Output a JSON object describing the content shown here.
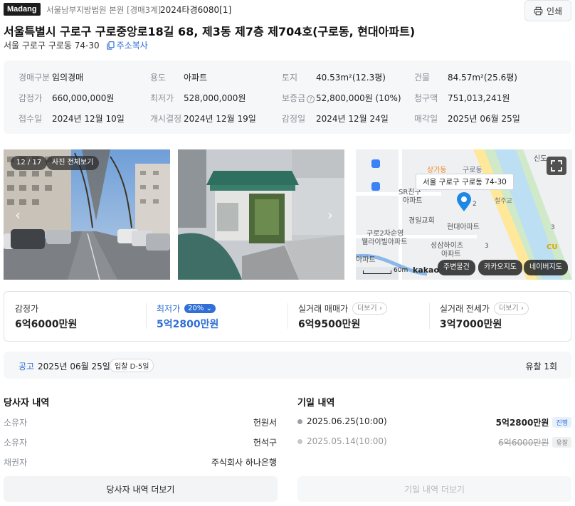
{
  "header": {
    "logo": "Madang",
    "court": "서울남부지방법원 본원 [경매3계]",
    "case_no": "2024타경6080[1]",
    "print_label": "인쇄"
  },
  "title": "서울특별시 구로구 구로중앙로18길 68, 제3동 제7층 제704호(구로동, 현대아파트)",
  "sub_address": "서울 구로구 구로동 74-30",
  "copy_label": "주소복사",
  "info": [
    [
      {
        "label": "경매구분",
        "value": "임의경매"
      },
      {
        "label": "용도",
        "value": "아파트"
      },
      {
        "label": "토지",
        "value": "40.53m²(12.3평)"
      },
      {
        "label": "건물",
        "value": "84.57m²(25.6평)"
      }
    ],
    [
      {
        "label": "감정가",
        "value": "660,000,000원"
      },
      {
        "label": "최저가",
        "value": "528,000,000원"
      },
      {
        "label": "보증금",
        "value": "52,800,000원 (10%)"
      },
      {
        "label": "청구액",
        "value": "751,013,241원"
      }
    ],
    [
      {
        "label": "접수일",
        "value": "2024년 12월 10일"
      },
      {
        "label": "개시결정",
        "value": "2024년 12월 19일"
      },
      {
        "label": "감정일",
        "value": "2024년 12월 24일"
      },
      {
        "label": "매각일",
        "value": "2025년 06월 25일"
      }
    ]
  ],
  "photos": {
    "counter": "12 / 17",
    "view_all": "사진 전체보기"
  },
  "map": {
    "popup": "서울 구로구 구로동 74-30",
    "labels": [
      "상가동",
      "구로동",
      "SR친구",
      "아파트",
      "경일교회",
      "구로2차순영",
      "웰라이빌아파트",
      "현대아파트",
      "성삼하이츠",
      "아파트",
      "아파트",
      "신도",
      "CU",
      "철주교",
      "2",
      "3",
      "3"
    ],
    "scale": "60m",
    "brand": "kakao",
    "buttons": [
      "주변물건",
      "카카오지도",
      "네이버지도"
    ]
  },
  "price": {
    "appraisal_label": "감정가",
    "appraisal_value": "6억6000만원",
    "min_label": "최저가",
    "min_badge": "20%",
    "min_value": "5억2800만원",
    "sale_label": "실거래 매매가",
    "sale_more": "더보기",
    "sale_value": "6억9500만원",
    "lease_label": "실거래 전세가",
    "lease_more": "더보기",
    "lease_value": "3억7000만원"
  },
  "notice": {
    "label": "공고",
    "date": "2025년 06월 25일",
    "dday": "입찰 D-5일",
    "result": "유찰 1회"
  },
  "parties": {
    "title": "당사자 내역",
    "rows": [
      {
        "role": "소유자",
        "name": "헌원서"
      },
      {
        "role": "소유자",
        "name": "헌석구"
      },
      {
        "role": "채권자",
        "name": "주식회사 하나은행"
      }
    ],
    "more": "당사자 내역 더보기"
  },
  "schedule": {
    "title": "기일 내역",
    "rows": [
      {
        "date": "2025.06.25(10:00)",
        "price": "5억2800만원",
        "status": "진행"
      },
      {
        "date": "2025.05.14(10:00)",
        "price": "6억6000만원",
        "status": "유찰"
      }
    ],
    "more": "기일 내역 더보기"
  },
  "colors": {
    "accent": "#2f6fd6",
    "map_pin": "#1e88e5"
  }
}
